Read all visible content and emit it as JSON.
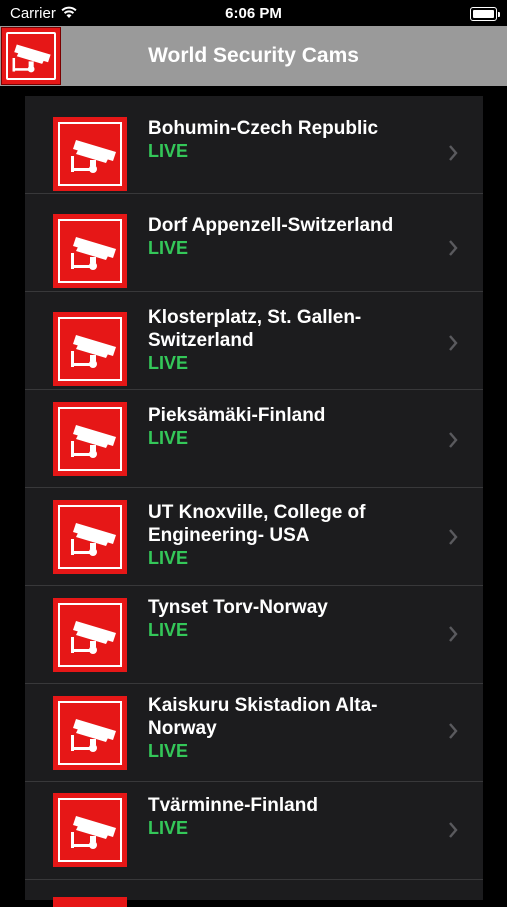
{
  "status_bar": {
    "carrier": "Carrier",
    "time": "6:06 PM"
  },
  "nav": {
    "title": "World Security Cams",
    "logo_icon": "security-camera-icon"
  },
  "colors": {
    "accent": "#e61717",
    "live": "#34c759",
    "nav_bg": "#9a9a9a",
    "panel_bg": "#1c1c1e"
  },
  "cams": [
    {
      "title": "Bohumin-Czech Republic",
      "status": "LIVE"
    },
    {
      "title": "Dorf Appenzell-Switzerland",
      "status": "LIVE"
    },
    {
      "title": "Klosterplatz, St. Gallen-Switzerland",
      "status": "LIVE"
    },
    {
      "title": "Pieksämäki-Finland",
      "status": "LIVE"
    },
    {
      "title": "UT Knoxville, College of Engineering- USA",
      "status": "LIVE"
    },
    {
      "title": "Tynset Torv-Norway",
      "status": "LIVE"
    },
    {
      "title": "Kaiskuru Skistadion Alta-Norway",
      "status": "LIVE"
    },
    {
      "title": "Tvärminne-Finland",
      "status": "LIVE"
    }
  ]
}
